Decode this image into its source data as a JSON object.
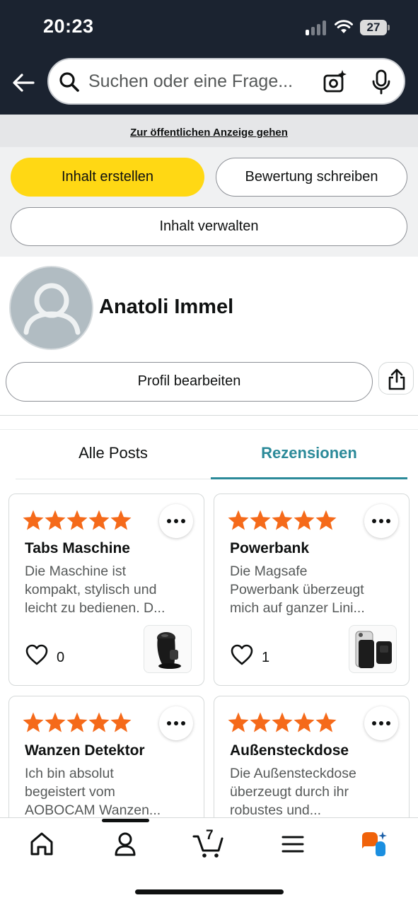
{
  "status_bar": {
    "time": "20:23",
    "battery": "27"
  },
  "search": {
    "placeholder": "Suchen oder eine Frage..."
  },
  "public_view_link": "Zur öffentlichen Anzeige gehen",
  "actions": {
    "create": "Inhalt erstellen",
    "review": "Bewertung schreiben",
    "manage": "Inhalt verwalten"
  },
  "profile": {
    "name": "Anatoli Immel",
    "edit_label": "Profil bearbeiten"
  },
  "tabs": [
    {
      "label": "Alle Posts",
      "active": false
    },
    {
      "label": "Rezensionen",
      "active": true
    }
  ],
  "colors": {
    "header_bg": "#1b2330",
    "primary_button": "#ffd814",
    "accent": "#2b8a99",
    "star": "#f56a1a"
  },
  "reviews": [
    {
      "rating": 5,
      "title": "Tabs Maschine",
      "lines": [
        "Die Maschine ist",
        "kompakt, stylisch und",
        "leicht zu bedienen. D..."
      ],
      "likes": "0",
      "image": "coffee-machine"
    },
    {
      "rating": 5,
      "title": "Powerbank",
      "lines": [
        "Die Magsafe",
        "Powerbank überzeugt",
        "mich auf ganzer Lini..."
      ],
      "likes": "1",
      "image": "powerbank"
    },
    {
      "rating": 5,
      "title": "Wanzen Detektor",
      "lines": [
        "Ich bin absolut",
        "begeistert vom",
        "AOBOCAM Wanzen..."
      ]
    },
    {
      "rating": 5,
      "title": "Außensteckdose",
      "lines": [
        "Die Außensteckdose",
        "überzeugt durch ihr",
        "robustes und..."
      ]
    }
  ],
  "bottom_nav": {
    "items": [
      "home-icon",
      "account-icon",
      "cart-icon",
      "menu-icon",
      "rufus-assistant-icon"
    ],
    "cart_count": "7"
  }
}
